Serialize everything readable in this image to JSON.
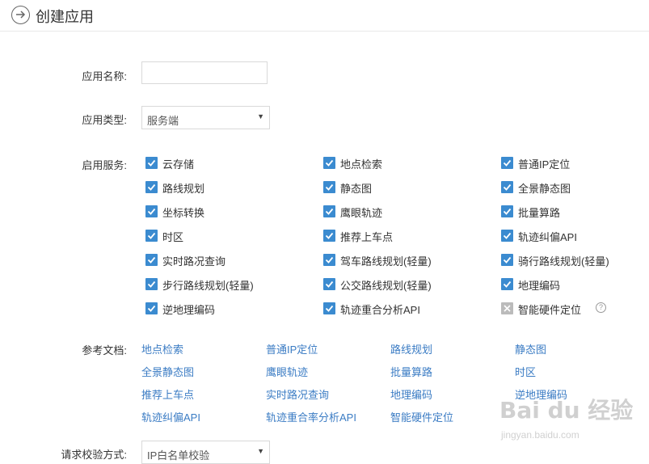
{
  "header": {
    "title": "创建应用"
  },
  "form": {
    "app_name_label": "应用名称:",
    "app_name_value": "",
    "app_type_label": "应用类型:",
    "app_type_value": "服务端",
    "services_label": "启用服务:",
    "docs_label": "参考文档:",
    "verify_label": "请求校验方式:",
    "verify_value": "IP白名单校验"
  },
  "services": [
    [
      "云存储",
      "地点检索",
      "普通IP定位"
    ],
    [
      "路线规划",
      "静态图",
      "全景静态图"
    ],
    [
      "坐标转换",
      "鹰眼轨迹",
      "批量算路"
    ],
    [
      "时区",
      "推荐上车点",
      "轨迹纠偏API"
    ],
    [
      "实时路况查询",
      "驾车路线规划(轻量)",
      "骑行路线规划(轻量)"
    ],
    [
      "步行路线规划(轻量)",
      "公交路线规划(轻量)",
      "地理编码"
    ],
    [
      "逆地理编码",
      "轨迹重合分析API",
      "智能硬件定位"
    ]
  ],
  "service_checked": [
    [
      true,
      true,
      true
    ],
    [
      true,
      true,
      true
    ],
    [
      true,
      true,
      true
    ],
    [
      true,
      true,
      true
    ],
    [
      true,
      true,
      true
    ],
    [
      true,
      true,
      true
    ],
    [
      true,
      true,
      false
    ]
  ],
  "help_icon_glyph": "?",
  "docs": [
    [
      "地点检索",
      "普通IP定位",
      "路线规划",
      "静态图"
    ],
    [
      "全景静态图",
      "鹰眼轨迹",
      "批量算路",
      "时区"
    ],
    [
      "推荐上车点",
      "实时路况查询",
      "地理编码",
      "逆地理编码"
    ],
    [
      "轨迹纠偏API",
      "轨迹重合率分析API",
      "智能硬件定位"
    ]
  ],
  "watermark": {
    "main": "Bai du 经验",
    "sub": "jingyan.baidu.com"
  },
  "colors": {
    "checkbox": "#3b8bd0",
    "checkbox_disabled": "#bbbbbb",
    "link": "#3b7cc4"
  }
}
